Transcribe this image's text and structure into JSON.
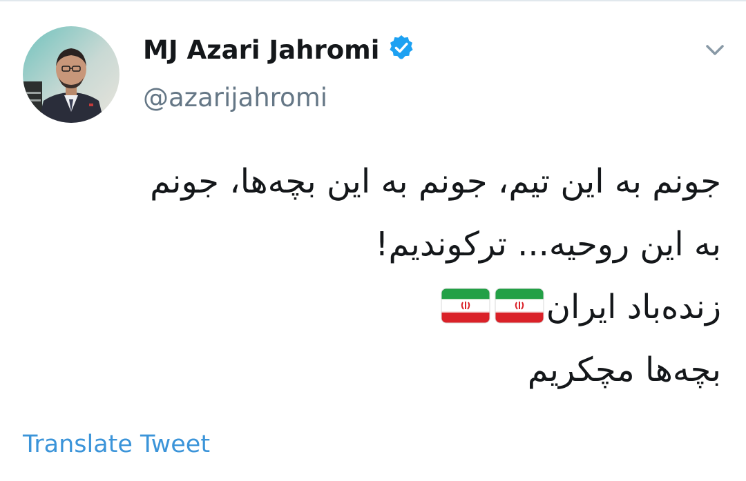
{
  "tweet": {
    "author": {
      "display_name": "MJ Azari Jahromi",
      "handle": "@azarijahromi",
      "verified": true,
      "verified_icon": "verified-badge-icon",
      "avatar_icon": "profile-photo"
    },
    "menu_icon": "chevron-down-icon",
    "lines": [
      "جونم به این تیم، جونم به این بچه‌ها، جونم",
      "به این روحیه... ترکوندیم!",
      "زنده‌باد ایران",
      "بچه‌ها مچکریم"
    ],
    "flag_icons": [
      "iran-flag-icon",
      "iran-flag-icon"
    ],
    "translate_label": "Translate Tweet"
  },
  "colors": {
    "text": "#14171a",
    "secondary": "#657786",
    "link": "#3b94d9",
    "verified": "#1da1f2",
    "caret": "#8899a6",
    "divider": "#e1e8ed"
  }
}
